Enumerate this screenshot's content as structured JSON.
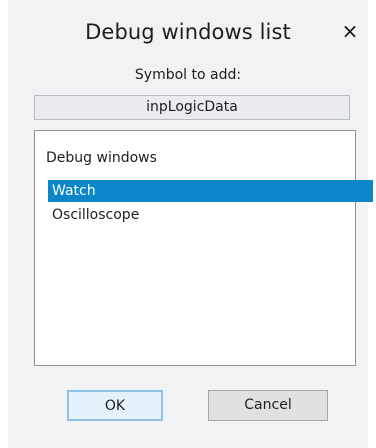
{
  "dialog": {
    "title": "Debug windows list",
    "close_icon": "×",
    "symbol_label": "Symbol to add:",
    "symbol_value": "inpLogicData",
    "list": {
      "header": "Debug windows",
      "items": [
        {
          "label": "Watch",
          "selected": true
        },
        {
          "label": "Oscilloscope",
          "selected": false
        }
      ]
    },
    "buttons": {
      "ok": "OK",
      "cancel": "Cancel"
    }
  },
  "colors": {
    "selection": "#0b86c9",
    "background": "#f1f2f4"
  }
}
